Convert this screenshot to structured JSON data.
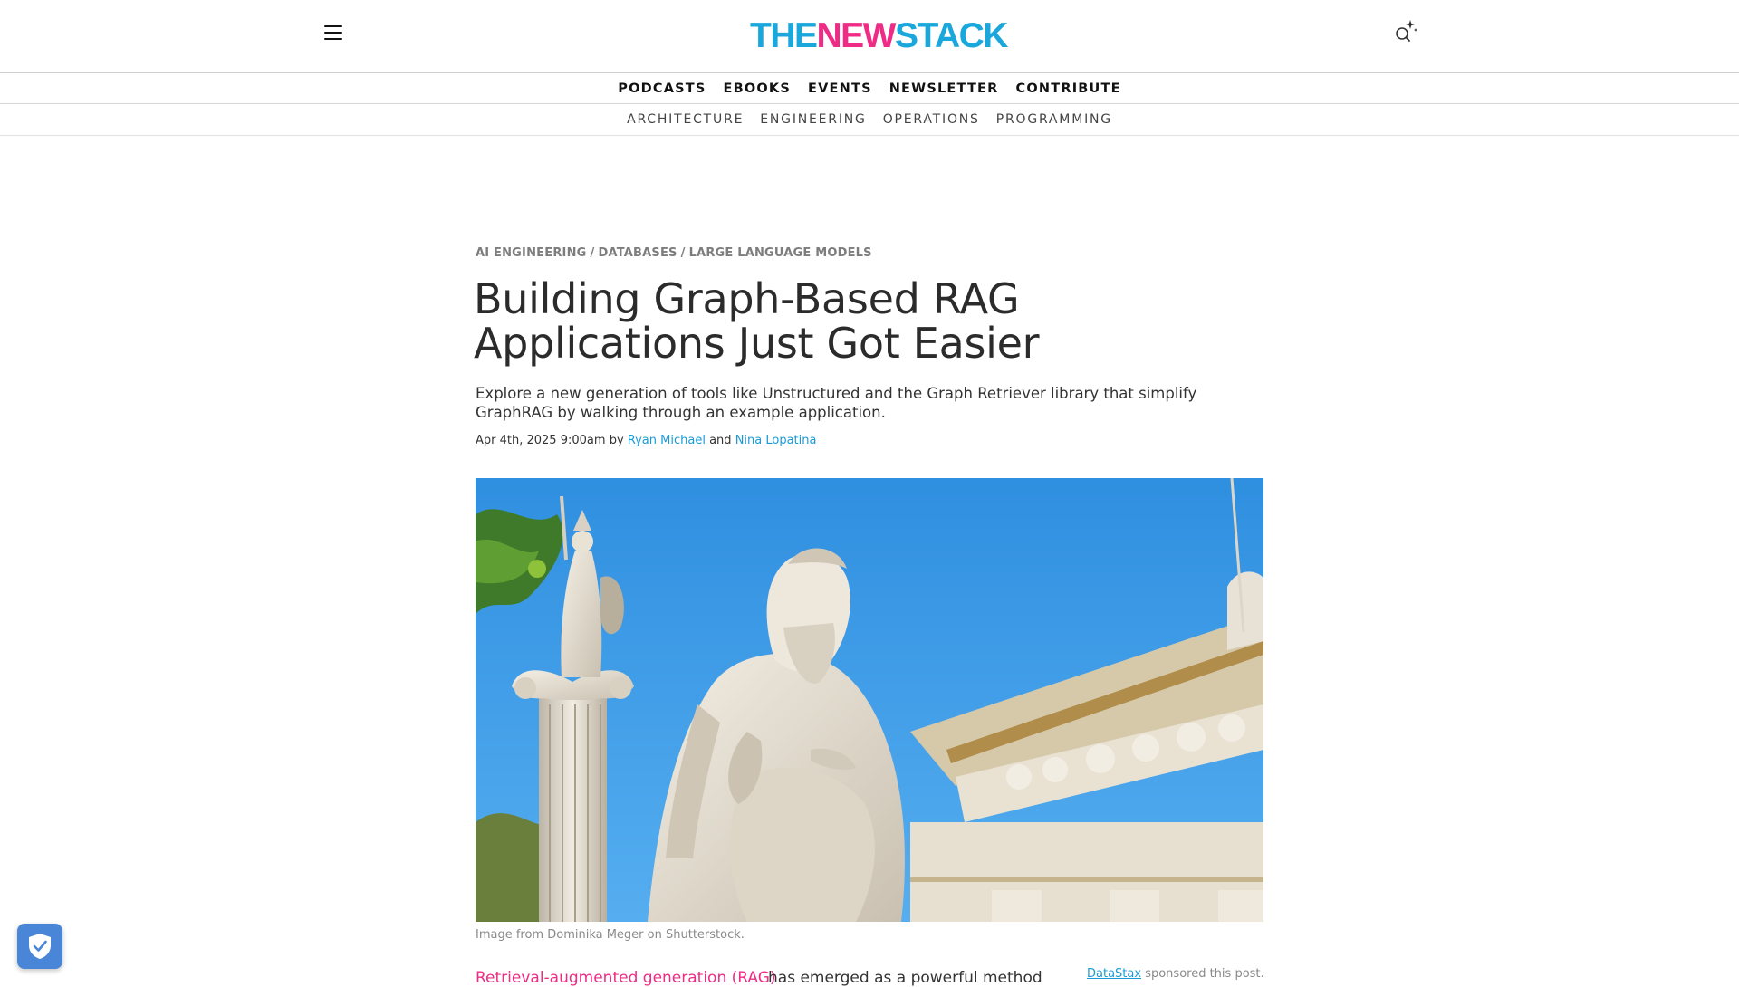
{
  "brand": {
    "part1": "THE",
    "part2": "NEW",
    "part3": "STACK",
    "color_blue": "#1aa7dc",
    "color_pink": "#ee2c86"
  },
  "header": {
    "menu_icon": "hamburger-menu-icon",
    "search_icon": "search-sparkle-icon"
  },
  "primary_nav": [
    "PODCASTS",
    "EBOOKS",
    "EVENTS",
    "NEWSLETTER",
    "CONTRIBUTE"
  ],
  "secondary_nav": [
    "ARCHITECTURE",
    "ENGINEERING",
    "OPERATIONS",
    "PROGRAMMING"
  ],
  "article": {
    "categories": [
      "AI ENGINEERING",
      "DATABASES",
      "LARGE LANGUAGE MODELS"
    ],
    "category_separator": "/",
    "title": "Building Graph-Based RAG Applications Just Got Easier",
    "subtitle": "Explore a new generation of tools like Unstructured and the Graph Retriever library that simplify GraphRAG by walking through an example application.",
    "date": "Apr 4th, 2025 9:00am",
    "by": "by",
    "and": "and",
    "authors": [
      "Ryan Michael",
      "Nina Lopatina"
    ],
    "image_caption": "Image from Dominika Meger on Shutterstock.",
    "body_link_text": "Retrieval-augmented generation (RAG)",
    "body_text_rest": "has emerged as a powerful method",
    "sponsor_name": "DataStax",
    "sponsor_text": "sponsored this post."
  },
  "widgets": {
    "privacy_icon": "shield-check-icon"
  }
}
